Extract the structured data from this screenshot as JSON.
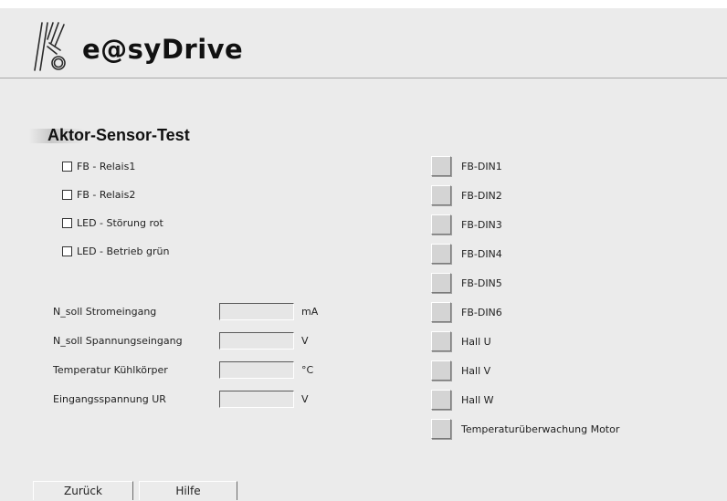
{
  "header": {
    "brand": "e@syDrive",
    "logo_icon": "kaco-logo-icon"
  },
  "section": {
    "title": "Aktor-Sensor-Test"
  },
  "checkboxes": [
    {
      "label": "FB - Relais1",
      "checked": false
    },
    {
      "label": "FB - Relais2",
      "checked": false
    },
    {
      "label": "LED - Störung rot",
      "checked": false
    },
    {
      "label": "LED - Betrieb grün",
      "checked": false
    }
  ],
  "fields": [
    {
      "label": "N_soll Stromeingang",
      "value": "",
      "unit": "mA"
    },
    {
      "label": "N_soll Spannungseingang",
      "value": "",
      "unit": "V"
    },
    {
      "label": "Temperatur Kühlkörper",
      "value": "",
      "unit": "°C"
    },
    {
      "label": "Eingangsspannung UR",
      "value": "",
      "unit": "V"
    }
  ],
  "indicators": [
    {
      "label": "FB-DIN1"
    },
    {
      "label": "FB-DIN2"
    },
    {
      "label": "FB-DIN3"
    },
    {
      "label": "FB-DIN4"
    },
    {
      "label": "FB-DIN5"
    },
    {
      "label": "FB-DIN6"
    },
    {
      "label": "Hall U"
    },
    {
      "label": "Hall V"
    },
    {
      "label": "Hall W"
    },
    {
      "label": "Temperaturüberwachung Motor"
    }
  ],
  "buttons": {
    "back": "Zurück",
    "help": "Hilfe"
  }
}
